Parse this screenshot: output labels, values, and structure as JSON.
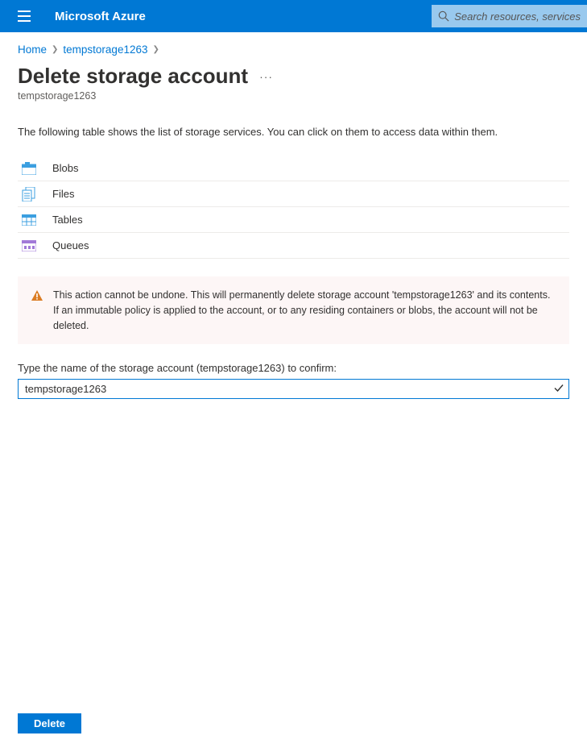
{
  "header": {
    "brand": "Microsoft Azure",
    "search_placeholder": "Search resources, services"
  },
  "breadcrumb": {
    "home": "Home",
    "resource": "tempstorage1263"
  },
  "page": {
    "title": "Delete storage account",
    "subtitle": "tempstorage1263",
    "intro": "The following table shows the list of storage services. You can click on them to access data within them."
  },
  "services": [
    {
      "label": "Blobs"
    },
    {
      "label": "Files"
    },
    {
      "label": "Tables"
    },
    {
      "label": "Queues"
    }
  ],
  "warning": {
    "text": "This action cannot be undone. This will permanently delete storage account 'tempstorage1263' and its contents. If an immutable policy is applied to the account, or to any residing containers or blobs, the account will not be deleted."
  },
  "confirm": {
    "label": "Type the name of the storage account (tempstorage1263) to confirm:",
    "value": "tempstorage1263"
  },
  "footer": {
    "delete_label": "Delete"
  }
}
